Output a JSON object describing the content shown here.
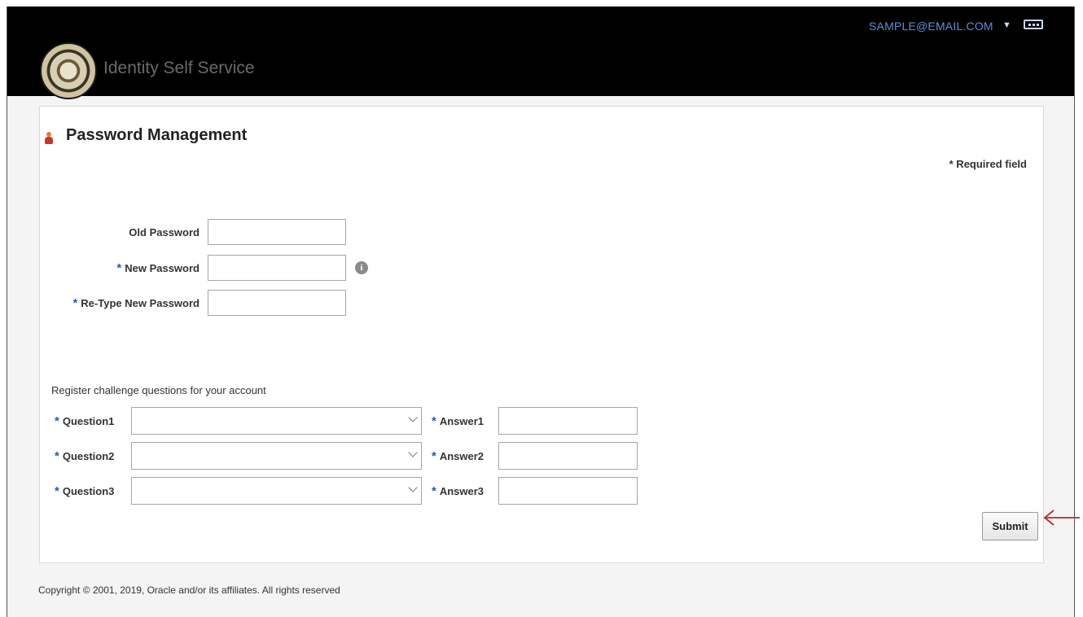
{
  "header": {
    "app_title": "Identity Self Service",
    "user_menu": "SAMPLE@EMAIL.COM",
    "icons": [
      "county-seal-logo",
      "caret-down-icon",
      "more-options-icon"
    ]
  },
  "page": {
    "title": "Password Management",
    "required_note": "* Required field"
  },
  "password_form": {
    "old_password_label": "Old Password",
    "new_password_label": "New Password",
    "retype_password_label": "Re-Type New Password",
    "required_marker": "*"
  },
  "challenge": {
    "section_label": "Register challenge questions for your account",
    "rows": [
      {
        "question_label": "Question1",
        "answer_label": "Answer1"
      },
      {
        "question_label": "Question2",
        "answer_label": "Answer2"
      },
      {
        "question_label": "Question3",
        "answer_label": "Answer3"
      }
    ]
  },
  "actions": {
    "submit_label": "Submit"
  },
  "footer": {
    "copyright": "Copyright © 2001, 2019, Oracle and/or its affiliates. All rights reserved"
  },
  "colors": {
    "header_bg": "#000000",
    "link_blue": "#5b8fd6",
    "required_star": "#1f5fb5",
    "annotation_arrow": "#c0272d"
  }
}
